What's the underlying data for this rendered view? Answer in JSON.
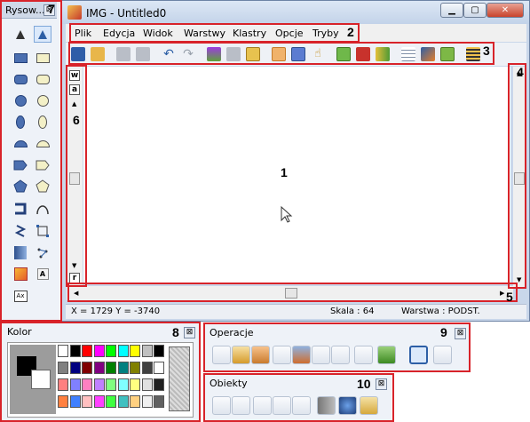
{
  "tool_palette": {
    "title": "Rysow...",
    "close": "⊠"
  },
  "window": {
    "title": "IMG - Untitled0",
    "menu": [
      "Plik",
      "Edycja",
      "Widok",
      "Warstwy",
      "Klastry",
      "Opcje",
      "Tryby"
    ],
    "status": {
      "coords": "X = 1729  Y = -3740",
      "scale": "Skala : 64",
      "layer": "Warstwa : PODST."
    },
    "side_buttons": [
      "w",
      "a",
      "r"
    ]
  },
  "colors": {
    "accent_red": "#d8232a"
  },
  "palettes": {
    "kolor": {
      "title": "Kolor"
    },
    "operacje": {
      "title": "Operacje"
    },
    "obiekty": {
      "title": "Obiekty"
    }
  },
  "annotations": [
    "1",
    "2",
    "3",
    "4",
    "5",
    "6",
    "7",
    "8",
    "9",
    "10"
  ],
  "color_grid": [
    [
      "#ffffff",
      "#000000",
      "#ff0000",
      "#ff00ff",
      "#00ff00",
      "#00ffff",
      "#ffff00",
      "#c0c0c0",
      "#000000"
    ],
    [
      "#808080",
      "#000080",
      "#800000",
      "#800080",
      "#008000",
      "#008080",
      "#808000",
      "#404040",
      "#ffffff"
    ],
    [
      "#ff8080",
      "#8080ff",
      "#ff80c0",
      "#c080ff",
      "#80ff80",
      "#80ffff",
      "#ffff80",
      "#e0e0e0",
      "#202020"
    ],
    [
      "#ff8040",
      "#4080ff",
      "#ffc0c0",
      "#ff40ff",
      "#40ff40",
      "#40c0c0",
      "#ffd080",
      "#f0f0f0",
      "#606060"
    ]
  ]
}
